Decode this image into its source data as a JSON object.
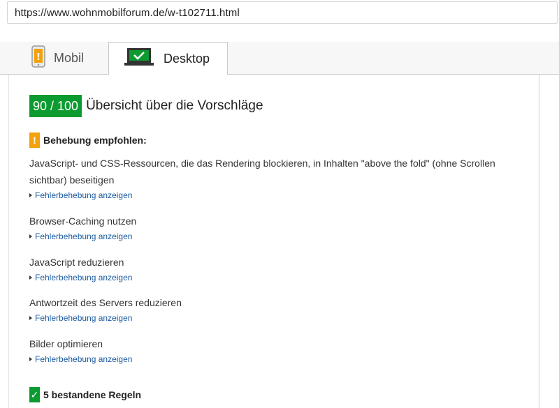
{
  "address_bar": {
    "url": "https://www.wohnmobilforum.de/w-t102711.html"
  },
  "tabs": [
    {
      "label": "Mobil",
      "icon": "mobile-phone-warning-icon",
      "selected": false
    },
    {
      "label": "Desktop",
      "icon": "desktop-monitor-check-icon",
      "selected": true
    }
  ],
  "summary": {
    "score": "90 / 100",
    "title": "Übersicht über die Vorschläge"
  },
  "fix_section": {
    "icon_glyph": "!",
    "title": "Behebung empfohlen:",
    "rules": [
      {
        "title": "JavaScript- und CSS-Ressourcen, die das Rendering blockieren, in Inhalten \"above the fold\" (ohne Scrollen sichtbar) beseitigen",
        "link": "Fehlerbehebung anzeigen"
      },
      {
        "title": "Browser-Caching nutzen",
        "link": "Fehlerbehebung anzeigen"
      },
      {
        "title": "JavaScript reduzieren",
        "link": "Fehlerbehebung anzeigen"
      },
      {
        "title": "Antwortzeit des Servers reduzieren",
        "link": "Fehlerbehebung anzeigen"
      },
      {
        "title": "Bilder optimieren",
        "link": "Fehlerbehebung anzeigen"
      }
    ]
  },
  "passed_section": {
    "icon_glyph": "✓",
    "title": "5 bestandene Regeln"
  },
  "colors": {
    "score_green": "#0b9b30",
    "warning_orange": "#f3a20b",
    "link_blue": "#1a5aa0"
  }
}
